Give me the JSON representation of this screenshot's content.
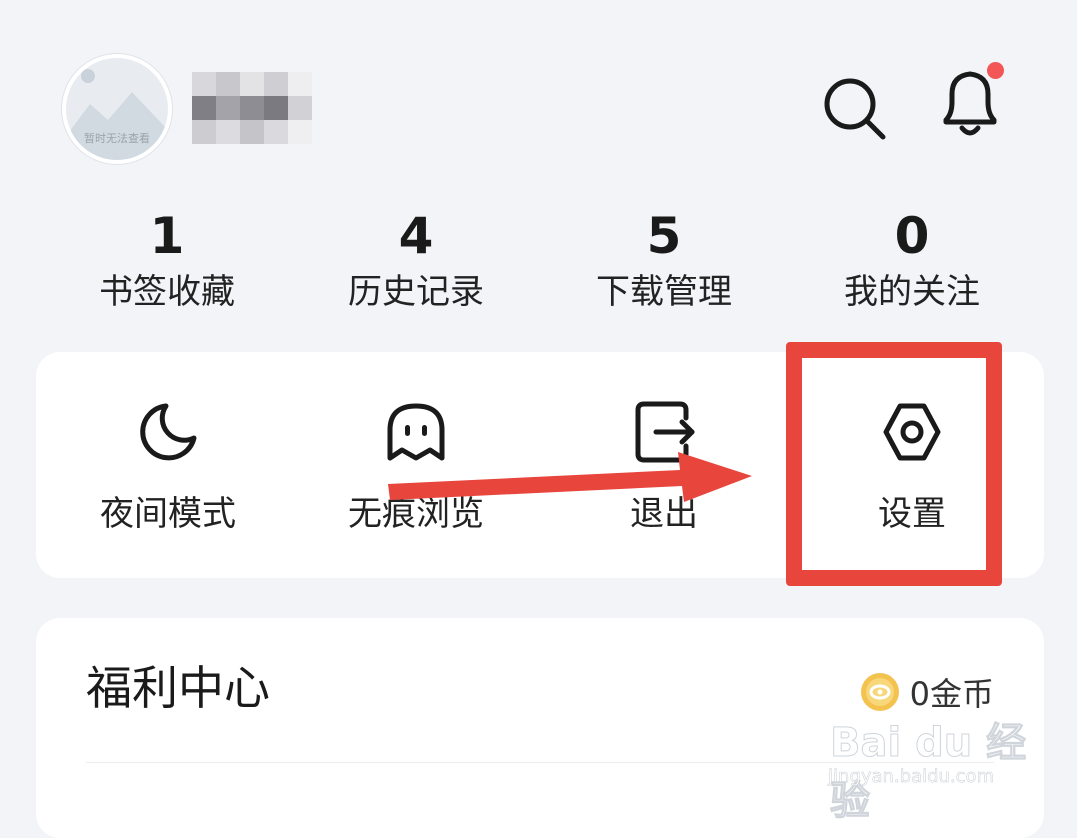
{
  "header": {
    "avatar_caption": "暂时无法查看",
    "username": "",
    "search_icon": "search-icon",
    "bell_icon": "bell-icon",
    "bell_badge_color": "#f25656"
  },
  "stats": [
    {
      "value": "1",
      "label": "书签收藏"
    },
    {
      "value": "4",
      "label": "历史记录"
    },
    {
      "value": "5",
      "label": "下载管理"
    },
    {
      "value": "0",
      "label": "我的关注"
    }
  ],
  "tools": [
    {
      "icon": "moon-icon",
      "label": "夜间模式"
    },
    {
      "icon": "ghost-icon",
      "label": "无痕浏览"
    },
    {
      "icon": "exit-icon",
      "label": "退出"
    },
    {
      "icon": "hexagon-settings-icon",
      "label": "设置"
    }
  ],
  "welfare": {
    "title": "福利中心",
    "coins_value": "0金币",
    "coin_icon": "coin-icon"
  },
  "annotation": {
    "highlight_color": "#e8453c"
  },
  "watermark": {
    "brand": "Bai du 经验",
    "url": "jingyan.baidu.com"
  }
}
